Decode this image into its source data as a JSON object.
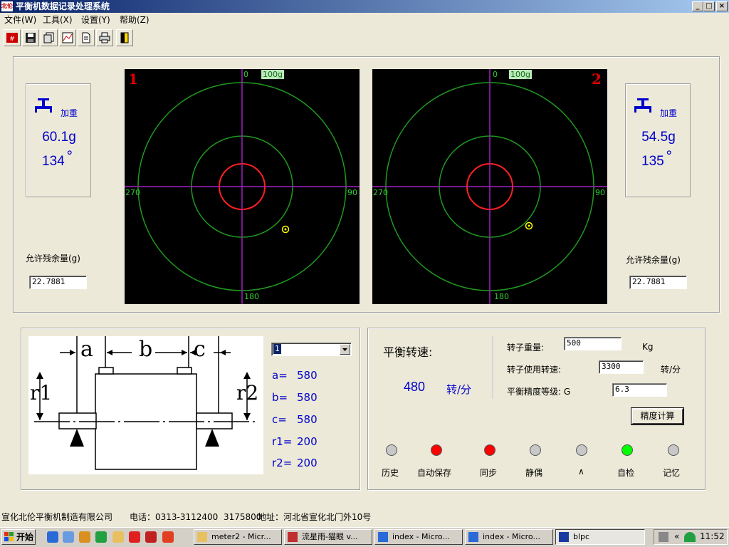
{
  "window": {
    "title": "平衡机数据记录处理系统",
    "icon_text": "北伦",
    "min_glyph": "_",
    "max_glyph": "□",
    "close_glyph": "×"
  },
  "menu": [
    "文件(W)",
    "工具(X)",
    "设置(Y)",
    "帮助(Z)"
  ],
  "toolbar": [
    "calc-icon",
    "save-icon",
    "copy-icon",
    "chart-icon",
    "doc-icon",
    "print-icon",
    "exit-icon"
  ],
  "plane1": {
    "number": "1",
    "add_label": "加重",
    "weight": "60.1g",
    "angle": "134",
    "degree": "°",
    "allow_label": "允许残余量(g)",
    "allow_value": "22.7881",
    "scale_label": "100g",
    "axis_0": "0",
    "axis_90": "90",
    "axis_180": "180",
    "axis_270": "270"
  },
  "plane2": {
    "number": "2",
    "add_label": "加重",
    "weight": "54.5g",
    "angle": "135",
    "degree": "°",
    "allow_label": "允许残余量(g)",
    "allow_value": "22.7881",
    "scale_label": "100g",
    "axis_0": "0",
    "axis_90": "90",
    "axis_180": "180",
    "axis_270": "270"
  },
  "rotor": {
    "label_a": "a",
    "label_b": "b",
    "label_c": "c",
    "label_r1": "r1",
    "label_r2": "r2",
    "select_value": "1",
    "params": [
      {
        "label": "a=",
        "value": "580"
      },
      {
        "label": "b=",
        "value": "580"
      },
      {
        "label": "c=",
        "value": "580"
      },
      {
        "label": "r1=",
        "value": "200"
      },
      {
        "label": "r2=",
        "value": "200"
      }
    ]
  },
  "balance": {
    "speed_label": "平衡转速:",
    "speed_value": "480",
    "speed_unit": "转/分",
    "rotor_weight_label": "转子重量:",
    "rotor_weight_value": "500",
    "rotor_weight_unit": "Kg",
    "use_speed_label": "转子使用转速:",
    "use_speed_value": "3300",
    "use_speed_unit": "转/分",
    "grade_label": "平衡精度等级: G",
    "grade_value": "6.3",
    "calc_button": "精度计算"
  },
  "indicators": [
    {
      "label": "历史",
      "color": "#c8c8c8"
    },
    {
      "label": "自动保存",
      "color": "#ff0000"
    },
    {
      "label": "同步",
      "color": "#ff0000"
    },
    {
      "label": "静偶",
      "color": "#c8c8c8"
    },
    {
      "label": "∧",
      "color": "#c8c8c8"
    },
    {
      "label": "自检",
      "color": "#00ff00"
    },
    {
      "label": "记忆",
      "color": "#c8c8c8"
    }
  ],
  "status": {
    "company": "宣化北伦平衡机制造有限公司",
    "phone": "电话：0313-3112400  3175800",
    "address": "地址：河北省宣化北门外10号"
  },
  "taskbar": {
    "start": "开始",
    "tasks": [
      "meter2 - Micr...",
      "流星雨-猫眼 v...",
      "index - Micro...",
      "index - Micro...",
      "blpc"
    ],
    "clock": "11:52"
  }
}
